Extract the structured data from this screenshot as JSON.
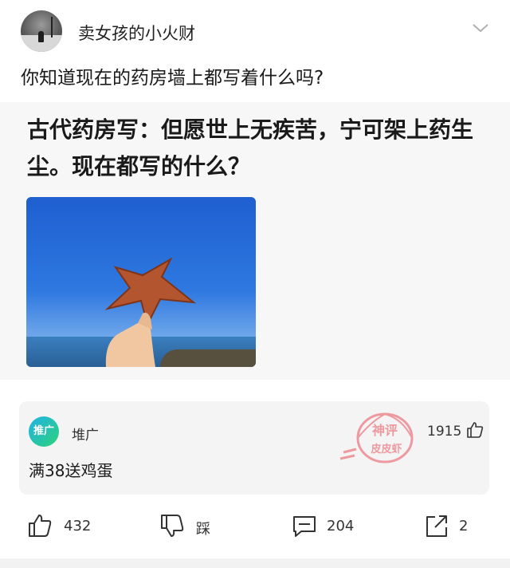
{
  "author": {
    "name": "卖女孩的小火财"
  },
  "post": {
    "question": "你知道现在的药房墙上都写着什么吗?",
    "image_text": "古代药房写：但愿世上无疾苦，宁可架上药生尘。现在都写的什么？"
  },
  "ad": {
    "logo_text": "推广",
    "advertiser": "堆广",
    "text": "满38送鸡蛋",
    "like_count": "1915"
  },
  "watermark": {
    "line1": "神评",
    "line2": "皮皮虾"
  },
  "actions": {
    "like_count": "432",
    "dislike_label": "踩",
    "comment_count": "204",
    "share_count": "2"
  },
  "icons": [
    "avatar",
    "chevron-down-icon",
    "thumbs-up-icon",
    "thumbs-down-icon",
    "comment-icon",
    "share-icon"
  ],
  "colors": {
    "background": "#ffffff",
    "card": "#f7f7f7",
    "ad_card": "#f4f4f4",
    "stamp": "#e8505b",
    "ad_logo": "#1fb3e6"
  }
}
